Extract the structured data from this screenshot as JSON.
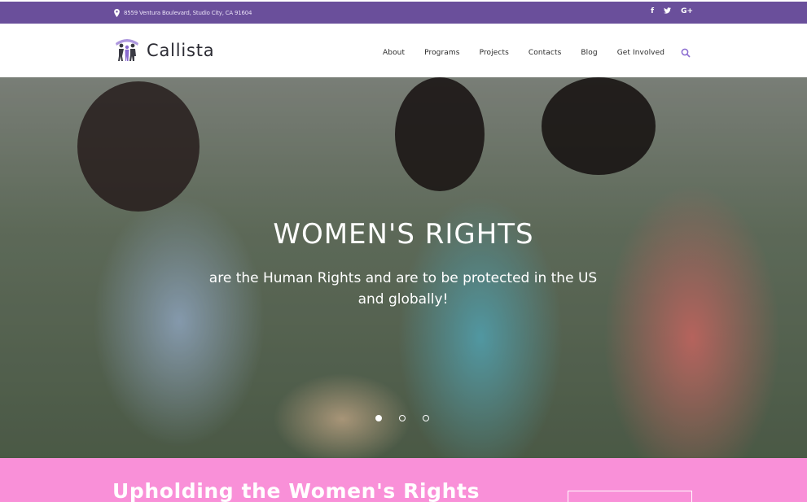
{
  "topbar": {
    "address": "8559 Ventura Boulevard, Studio City, CA 91604",
    "social": [
      "f",
      "🐦",
      "G+"
    ]
  },
  "header": {
    "logo_text": "Callista",
    "nav": [
      "About",
      "Programs",
      "Projects",
      "Contacts",
      "Blog",
      "Get Involved"
    ]
  },
  "hero": {
    "title": "WOMEN'S RIGHTS",
    "subtitle": "are the Human Rights and are to be protected in the US and globally!",
    "slides": 3,
    "active_slide": 1
  },
  "band": {
    "heading": "Upholding the Women's Rights"
  },
  "colors": {
    "topbar": "#6a4f9b",
    "accent": "#8a6bd0",
    "band": "#f990d8"
  }
}
